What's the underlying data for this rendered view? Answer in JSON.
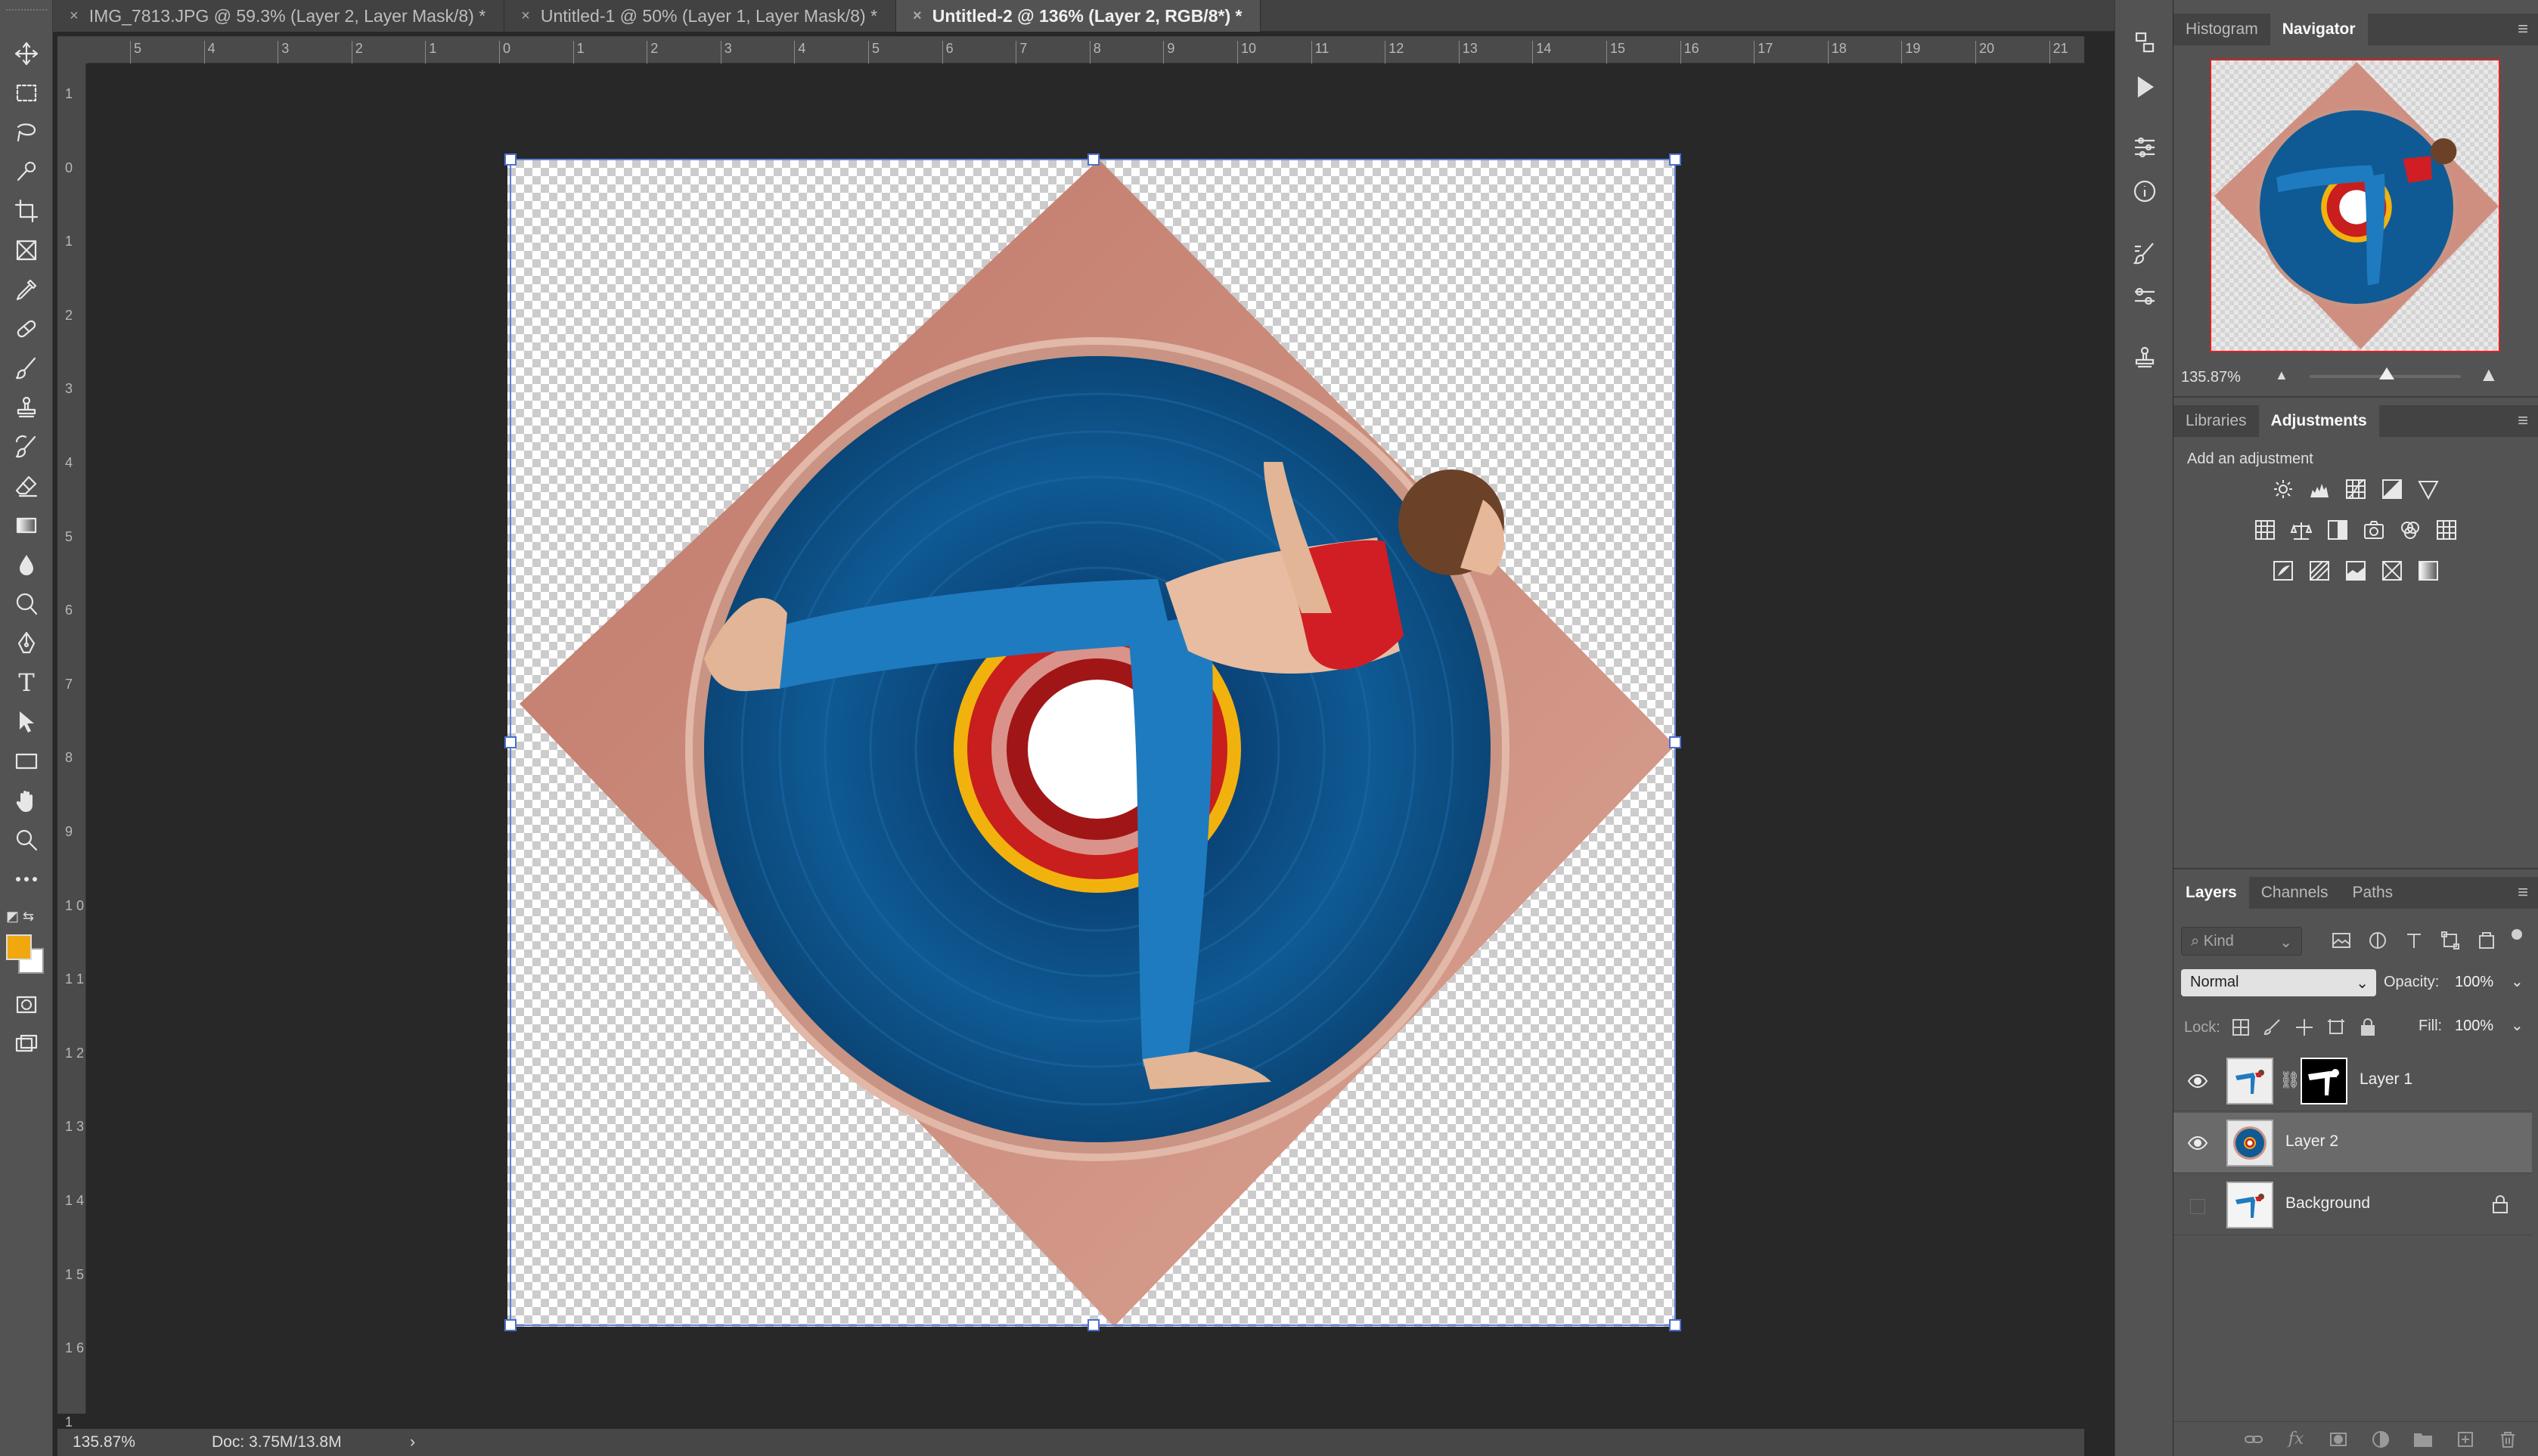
{
  "tabs": [
    {
      "label": "IMG_7813.JPG @ 59.3% (Layer 2, Layer Mask/8) *",
      "active": false
    },
    {
      "label": "Untitled-1 @ 50% (Layer 1, Layer Mask/8) *",
      "active": false
    },
    {
      "label": "Untitled-2 @ 136% (Layer 2, RGB/8*) *",
      "active": true
    }
  ],
  "tab_close_glyph": "×",
  "ruler": {
    "horizontal": [
      "5",
      "4",
      "3",
      "2",
      "1",
      "0",
      "1",
      "2",
      "3",
      "4",
      "5",
      "6",
      "7",
      "8",
      "9",
      "10",
      "11",
      "12",
      "13",
      "14",
      "15",
      "16",
      "17",
      "18",
      "19",
      "20",
      "21"
    ],
    "vertical": [
      "1",
      "0",
      "1",
      "2",
      "3",
      "4",
      "5",
      "6",
      "7",
      "8",
      "9",
      "1 0",
      "1 1",
      "1 2",
      "1 3",
      "1 4",
      "1 5",
      "1 6",
      "1"
    ]
  },
  "status": {
    "zoom": "135.87%",
    "doc_size": "Doc: 3.75M/13.8M",
    "arrow": "›"
  },
  "colors": {
    "foreground": "#f0a80e",
    "background": "#ffffff",
    "accent_selection": "#5d7fd6"
  },
  "navigator_panel": {
    "tabs": [
      "Histogram",
      "Navigator"
    ],
    "active_tab": "Navigator",
    "zoom": "135.87%"
  },
  "adjustments_panel": {
    "tabs": [
      "Libraries",
      "Adjustments"
    ],
    "active_tab": "Adjustments",
    "title": "Add an adjustment",
    "row1": [
      "brightness-contrast-icon",
      "levels-icon",
      "curves-icon",
      "exposure-icon",
      "vibrance-icon"
    ],
    "row2": [
      "hue-saturation-icon",
      "color-balance-icon",
      "black-white-icon",
      "photo-filter-icon",
      "channel-mixer-icon",
      "color-lookup-icon"
    ],
    "row3": [
      "invert-icon",
      "posterize-icon",
      "threshold-icon",
      "selective-color-icon",
      "gradient-map-icon"
    ]
  },
  "layers_panel": {
    "tabs": [
      "Layers",
      "Channels",
      "Paths"
    ],
    "active_tab": "Layers",
    "filter_placeholder": "Kind",
    "blend_mode": "Normal",
    "opacity_label": "Opacity:",
    "opacity_value": "100%",
    "lock_label": "Lock:",
    "fill_label": "Fill:",
    "fill_value": "100%",
    "layers": [
      {
        "name": "Layer 1",
        "visible": true,
        "selected": false,
        "has_mask": true,
        "locked": false
      },
      {
        "name": "Layer 2",
        "visible": true,
        "selected": true,
        "has_mask": false,
        "locked": false
      },
      {
        "name": "Background",
        "visible": false,
        "selected": false,
        "has_mask": false,
        "locked": true
      }
    ]
  }
}
